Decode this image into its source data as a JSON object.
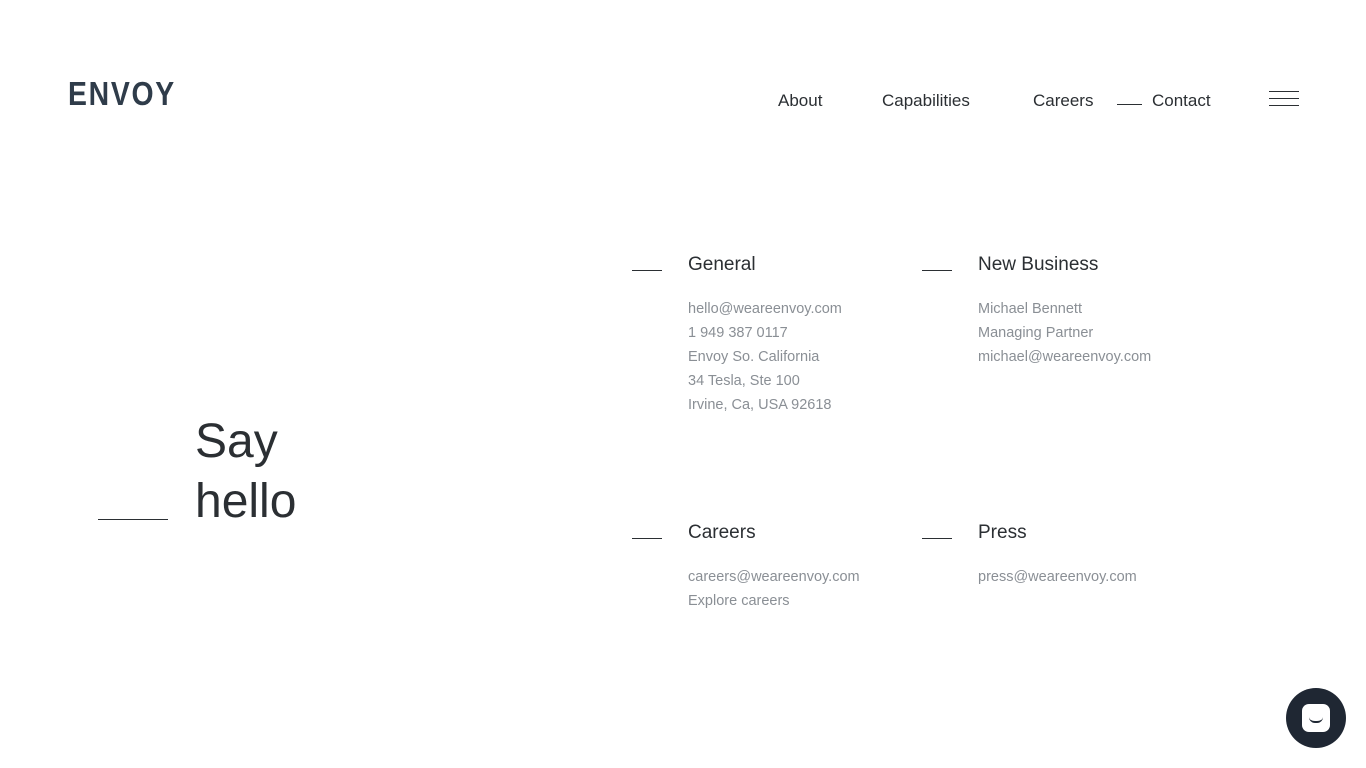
{
  "header": {
    "logo": "ENVOY",
    "nav": {
      "about": "About",
      "capabilities": "Capabilities",
      "careers": "Careers",
      "contact": "Contact"
    },
    "menu_icon": "hamburger-menu-icon"
  },
  "hero": {
    "line1": "Say",
    "line2": "hello"
  },
  "contacts": {
    "general": {
      "title": "General",
      "lines": [
        "hello@weareenvoy.com",
        "1 949 387 0117",
        "Envoy So. California",
        "34 Tesla, Ste 100",
        "Irvine, Ca, USA 92618"
      ]
    },
    "new_business": {
      "title": "New Business",
      "lines": [
        "Michael Bennett",
        "Managing Partner",
        "michael@weareenvoy.com"
      ]
    },
    "careers": {
      "title": "Careers",
      "lines": [
        "careers@weareenvoy.com",
        "Explore careers"
      ]
    },
    "press": {
      "title": "Press",
      "lines": [
        "press@weareenvoy.com"
      ]
    }
  },
  "chat": {
    "icon": "chat-launcher-icon",
    "color": "#1f2733"
  },
  "colors": {
    "text": "#2b2f33",
    "muted": "#8a8f95",
    "logo": "#2f3c4a"
  }
}
